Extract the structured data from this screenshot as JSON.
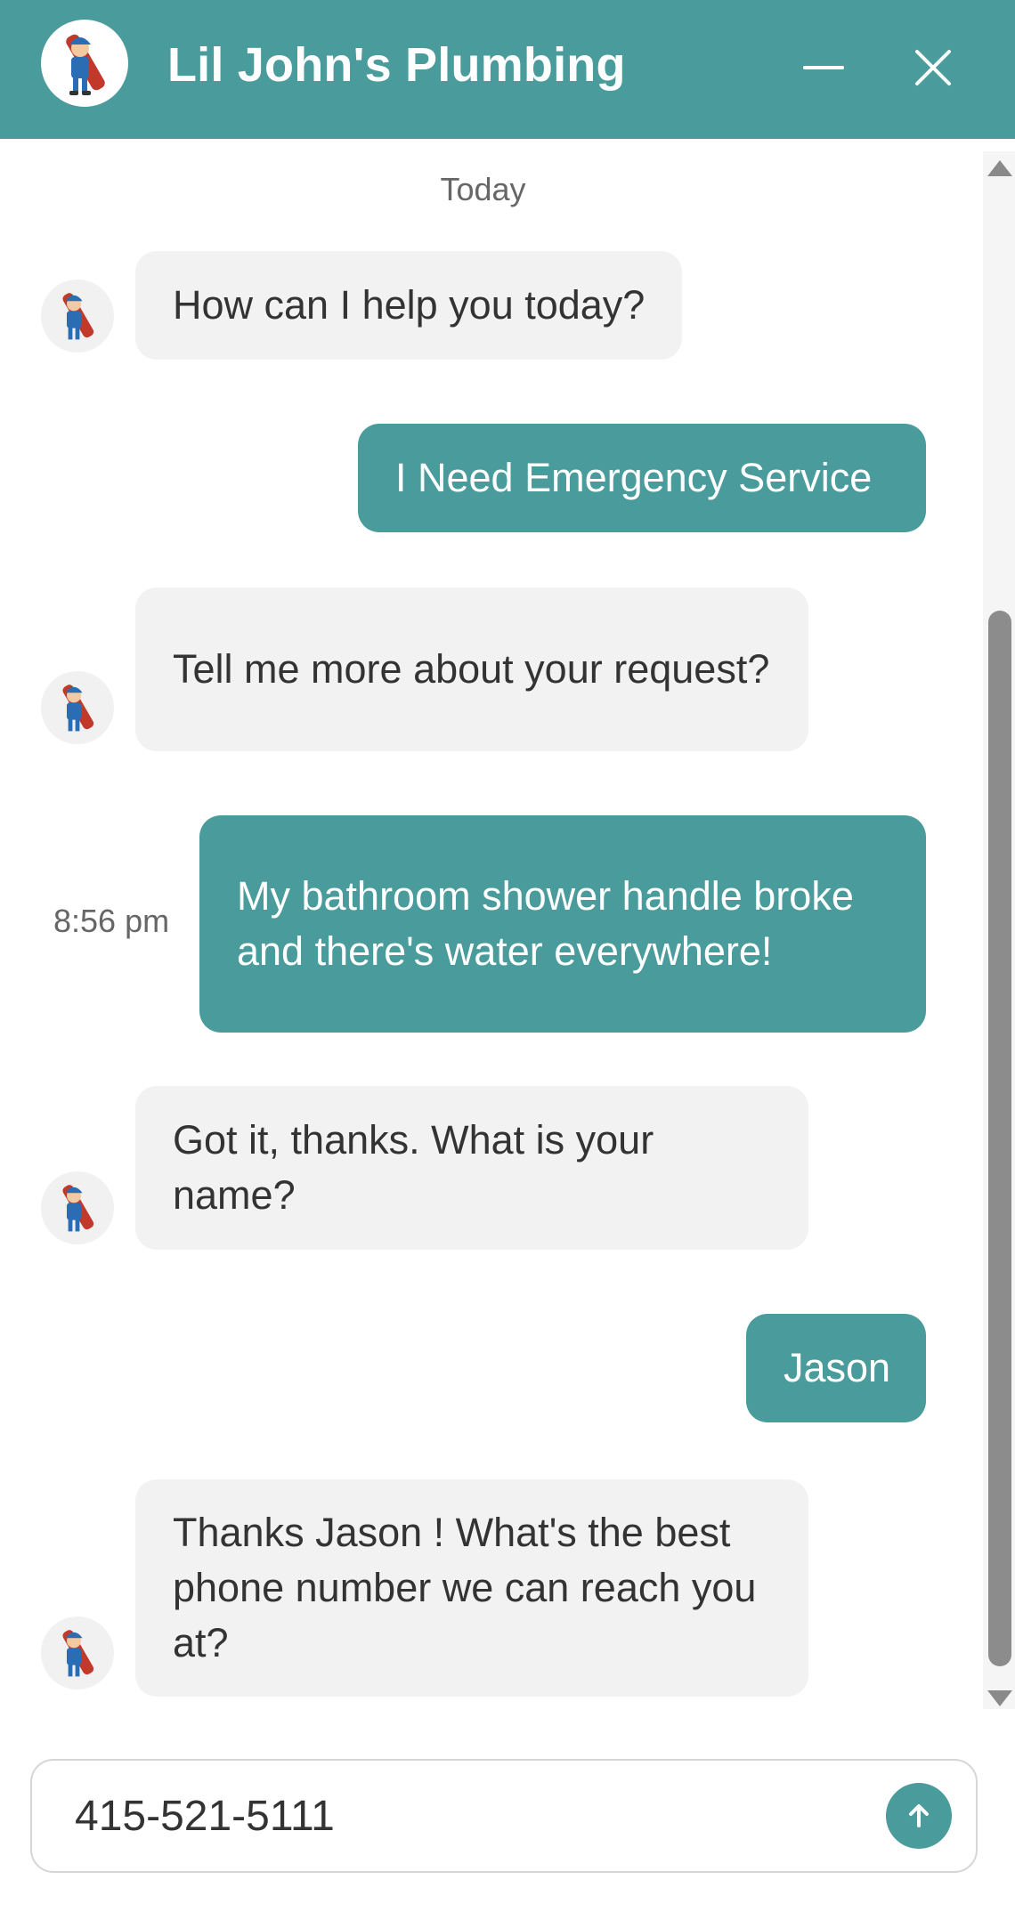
{
  "header": {
    "title": "Lil John's Plumbing",
    "avatar_icon": "plumber-mascot-icon",
    "minimize_icon": "minimize-icon",
    "close_icon": "close-icon",
    "background": "#4a9b9b"
  },
  "conversation": {
    "day_label": "Today",
    "messages": [
      {
        "sender": "bot",
        "text": "How can I help you today?"
      },
      {
        "sender": "user",
        "text": "I Need Emergency Service"
      },
      {
        "sender": "bot",
        "text": "Tell me more about your request?"
      },
      {
        "sender": "user",
        "text": "My bathroom shower handle broke and there's water everywhere!",
        "time": "8:56 pm"
      },
      {
        "sender": "bot",
        "text": "Got it, thanks. What is your name?"
      },
      {
        "sender": "user",
        "text": "Jason"
      },
      {
        "sender": "bot",
        "text": "Thanks Jason ! What's the best phone number we can reach you at?"
      }
    ]
  },
  "composer": {
    "value": "415-521-5111",
    "send_icon": "arrow-up-icon"
  },
  "colors": {
    "accent": "#4a9b9b",
    "bot_bubble": "#f2f2f2",
    "bot_text": "#333333",
    "user_text": "#ffffff"
  }
}
